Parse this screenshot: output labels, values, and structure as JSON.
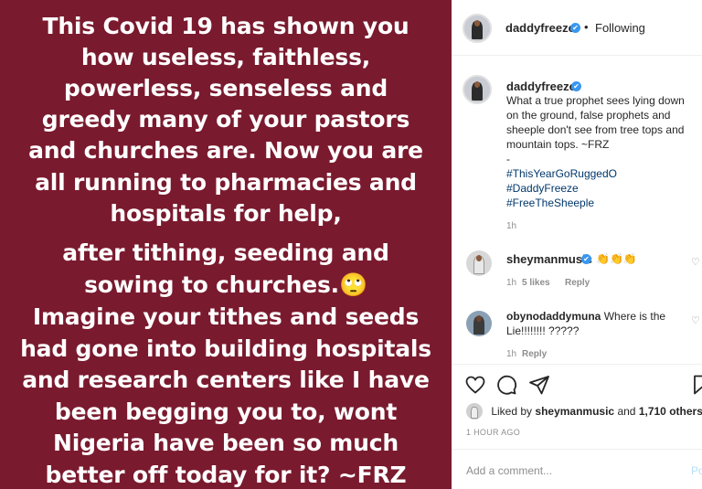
{
  "post_image": {
    "lines": [
      "This Covid 19 has shown you",
      "how useless, faithless,",
      "powerless, senseless and",
      "greedy many of your pastors",
      "and churches are. Now you are",
      "all running to pharmacies and",
      "hospitals for help,",
      "after tithing, seeding and",
      "sowing to churches.🙄",
      "Imagine your tithes and seeds",
      "had gone into building hospitals",
      "and research centers like I have",
      "been begging you to, wont",
      "Nigeria have been so much",
      "better off today for it? ~FRZ"
    ]
  },
  "header": {
    "username": "daddyfreeze",
    "verified_icon": "✔",
    "separator": "•",
    "follow_status": "Following"
  },
  "caption": {
    "username": "daddyfreeze",
    "verified_icon": "✔",
    "text": "What a true prophet sees lying down on the ground, false prophets and sheeple don't see from tree tops and mountain tops. ~FRZ",
    "dash": "-",
    "hashtags": [
      "#ThisYearGoRuggedO",
      "#DaddyFreeze",
      "#FreeTheSheeple"
    ],
    "time": "1h"
  },
  "comments": [
    {
      "username": "sheymanmusic",
      "verified_icon": "✔",
      "text": "👏👏👏",
      "time": "1h",
      "likes": "5 likes",
      "reply": "Reply"
    },
    {
      "username": "obynodaddymuna",
      "text": "Where is the Lie!!!!!!!! ?????",
      "time": "1h",
      "reply": "Reply"
    }
  ],
  "likes": {
    "prefix": "Liked by",
    "user": "sheymanmusic",
    "middle": "and",
    "others": "1,710 others"
  },
  "timestamp": "1 HOUR AGO",
  "add_comment": {
    "placeholder": "Add a comment...",
    "post_label": "Po"
  },
  "colors": {
    "post_background": "#7a1a2e",
    "verified": "#3897f0",
    "hashtag": "#00376b"
  }
}
